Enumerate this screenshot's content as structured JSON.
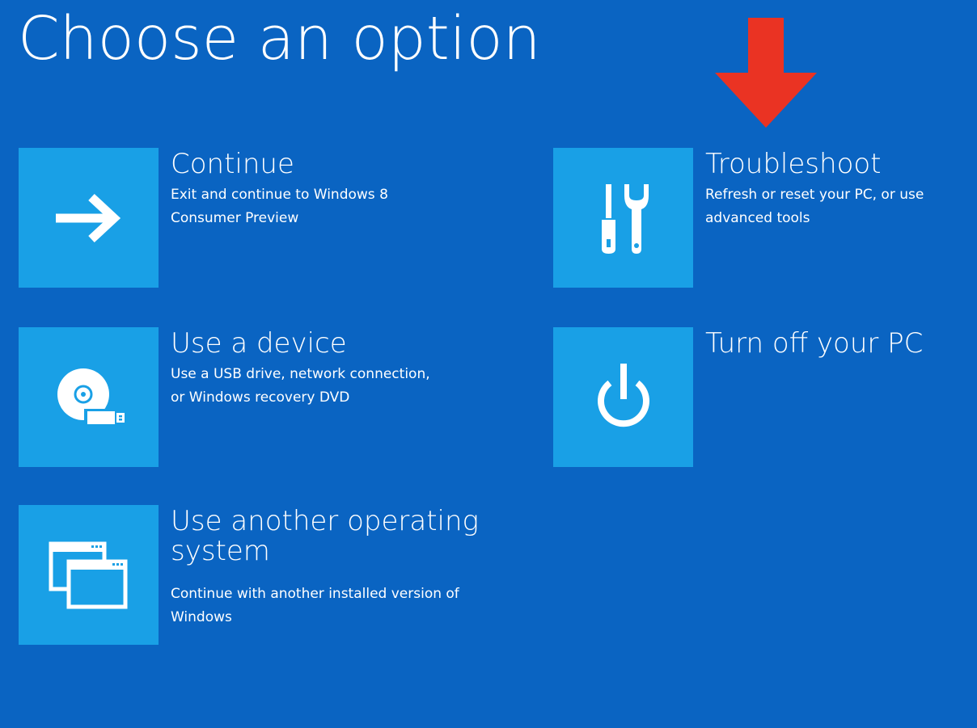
{
  "page": {
    "title": "Choose an option"
  },
  "colors": {
    "background": "#0a64c2",
    "tile": "#19a0e6",
    "text": "#ffffff",
    "arrow": "#ea3323"
  },
  "options": {
    "continue": {
      "title": "Continue",
      "description": "Exit and continue to Windows 8 Consumer Preview",
      "icon": "arrow-right-icon"
    },
    "use_device": {
      "title": "Use a device",
      "description": "Use a USB drive, network connection, or Windows recovery DVD",
      "icon": "disc-usb-icon"
    },
    "another_os": {
      "title": "Use another operating system",
      "description": "Continue with another installed version of Windows",
      "icon": "windows-stack-icon"
    },
    "troubleshoot": {
      "title": "Troubleshoot",
      "description": "Refresh or reset your PC, or use advanced tools",
      "icon": "tools-icon"
    },
    "turn_off": {
      "title": "Turn off your PC",
      "icon": "power-icon"
    }
  },
  "annotation": {
    "icon": "red-down-arrow-icon"
  }
}
